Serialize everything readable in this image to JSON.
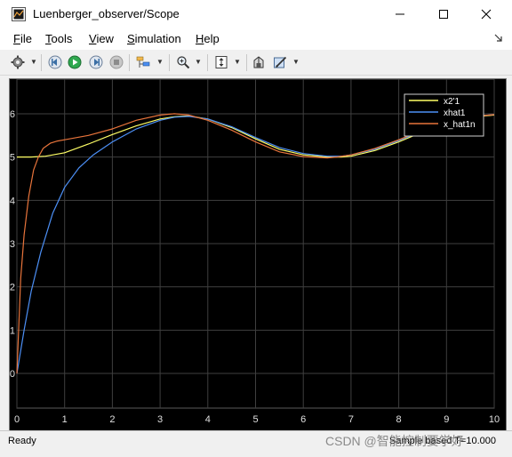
{
  "window": {
    "title": "Luenberger_observer/Scope",
    "controls": {
      "minimize": "—",
      "maximize": "☐",
      "close": "✕"
    }
  },
  "menu": {
    "items": [
      {
        "mnemonic": "F",
        "rest": "ile"
      },
      {
        "mnemonic": "T",
        "rest": "ools"
      },
      {
        "mnemonic": "V",
        "rest": "iew"
      },
      {
        "mnemonic": "S",
        "rest": "imulation"
      },
      {
        "mnemonic": "H",
        "rest": "elp"
      }
    ]
  },
  "toolbar": {
    "icons": [
      "gear-icon",
      "step-back-icon",
      "run-icon",
      "step-forward-icon",
      "stop-icon",
      "triggers-icon",
      "zoom-icon",
      "autoscale-icon",
      "highlight-icon",
      "properties-icon"
    ]
  },
  "chart_data": {
    "type": "line",
    "xlim": [
      0,
      10
    ],
    "ylim": [
      -0.8,
      6.8
    ],
    "x_ticks": [
      "0",
      "1",
      "2",
      "3",
      "4",
      "5",
      "6",
      "7",
      "8",
      "9",
      "10"
    ],
    "y_ticks": [
      "0",
      "1",
      "2",
      "3",
      "4",
      "5",
      "6"
    ],
    "grid": true,
    "legend_position": "top-right",
    "background": "#000000",
    "series": [
      {
        "name": "x2'1",
        "color": "#ffff66",
        "x": [
          0,
          0.3,
          0.6,
          1,
          1.5,
          2,
          2.5,
          3,
          3.3,
          3.6,
          4,
          4.5,
          5,
          5.5,
          6,
          6.5,
          6.8,
          7,
          7.5,
          8,
          8.5,
          9,
          9.5,
          10
        ],
        "y": [
          5,
          5,
          5.02,
          5.1,
          5.3,
          5.52,
          5.72,
          5.88,
          5.93,
          5.95,
          5.88,
          5.68,
          5.42,
          5.18,
          5.05,
          5.0,
          5.0,
          5.02,
          5.15,
          5.35,
          5.58,
          5.78,
          5.92,
          5.97
        ]
      },
      {
        "name": "xhat1",
        "color": "#4c8ff5",
        "x": [
          0,
          0.15,
          0.3,
          0.5,
          0.75,
          1,
          1.3,
          1.6,
          2,
          2.5,
          3,
          3.3,
          3.6,
          4,
          4.5,
          5,
          5.5,
          6,
          6.5,
          6.8,
          7,
          7.5,
          8,
          8.5,
          9,
          9.5,
          10
        ],
        "y": [
          0,
          1,
          1.9,
          2.8,
          3.7,
          4.3,
          4.75,
          5.05,
          5.35,
          5.65,
          5.85,
          5.92,
          5.94,
          5.88,
          5.7,
          5.45,
          5.22,
          5.08,
          5.02,
          5.02,
          5.05,
          5.18,
          5.38,
          5.6,
          5.8,
          5.93,
          5.98
        ]
      },
      {
        "name": "x_hat1n",
        "color": "#e8743b",
        "x": [
          0,
          0.08,
          0.15,
          0.25,
          0.35,
          0.45,
          0.55,
          0.7,
          0.85,
          1,
          1.5,
          2,
          2.5,
          3,
          3.3,
          3.6,
          4,
          4.5,
          5,
          5.5,
          6,
          6.5,
          6.7,
          7,
          7.5,
          8,
          8.5,
          9,
          9.5,
          10
        ],
        "y": [
          0,
          2.2,
          3.2,
          4.1,
          4.7,
          5.0,
          5.2,
          5.32,
          5.37,
          5.4,
          5.5,
          5.65,
          5.85,
          5.97,
          6.0,
          5.97,
          5.85,
          5.62,
          5.35,
          5.12,
          5.01,
          4.98,
          5.0,
          5.05,
          5.2,
          5.4,
          5.62,
          5.8,
          5.93,
          5.98
        ]
      }
    ]
  },
  "status": {
    "left": "Ready",
    "right": "Sample based  T=10.000"
  },
  "watermark": "CSDN @智能控制要学好"
}
